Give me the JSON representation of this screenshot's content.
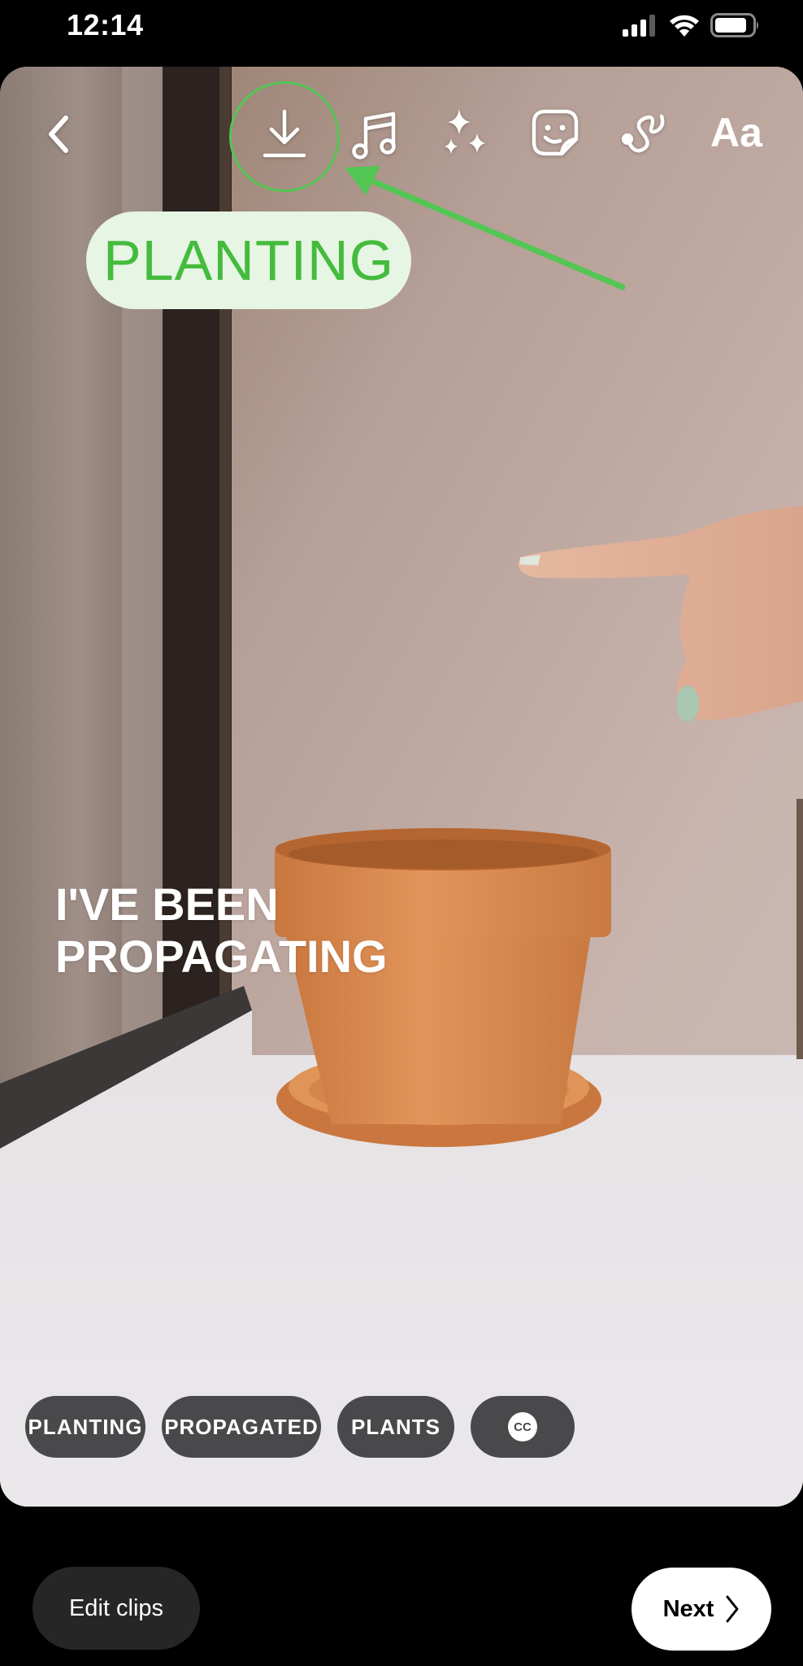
{
  "status_bar": {
    "time": "12:14",
    "icons": [
      "cellular-signal-icon",
      "wifi-icon",
      "battery-icon"
    ]
  },
  "toolbar": {
    "back_icon": "chevron-left-icon",
    "tools": [
      {
        "name": "download",
        "icon": "download-icon"
      },
      {
        "name": "music",
        "icon": "music-note-icon"
      },
      {
        "name": "effects",
        "icon": "sparkles-icon"
      },
      {
        "name": "stickers",
        "icon": "sticker-icon"
      },
      {
        "name": "draw",
        "icon": "squiggle-draw-icon"
      },
      {
        "name": "text",
        "icon": "text-icon",
        "label": "Aa"
      }
    ]
  },
  "annotation": {
    "label": "PLANTING",
    "color": "#53c653",
    "label_text_color": "#44bb3c",
    "label_bg": "#e6f5e4",
    "target": "download"
  },
  "overlay_text": {
    "line1": "I'VE BEEN",
    "line2": "PROPAGATING"
  },
  "caption_chips": [
    {
      "label": "PLANTING"
    },
    {
      "label": "PROPAGATED"
    },
    {
      "label": "PLANTS"
    },
    {
      "label": "CC",
      "icon": "closed-captions-icon"
    }
  ],
  "bottom_actions": {
    "edit_clips": "Edit clips",
    "next": "Next"
  }
}
